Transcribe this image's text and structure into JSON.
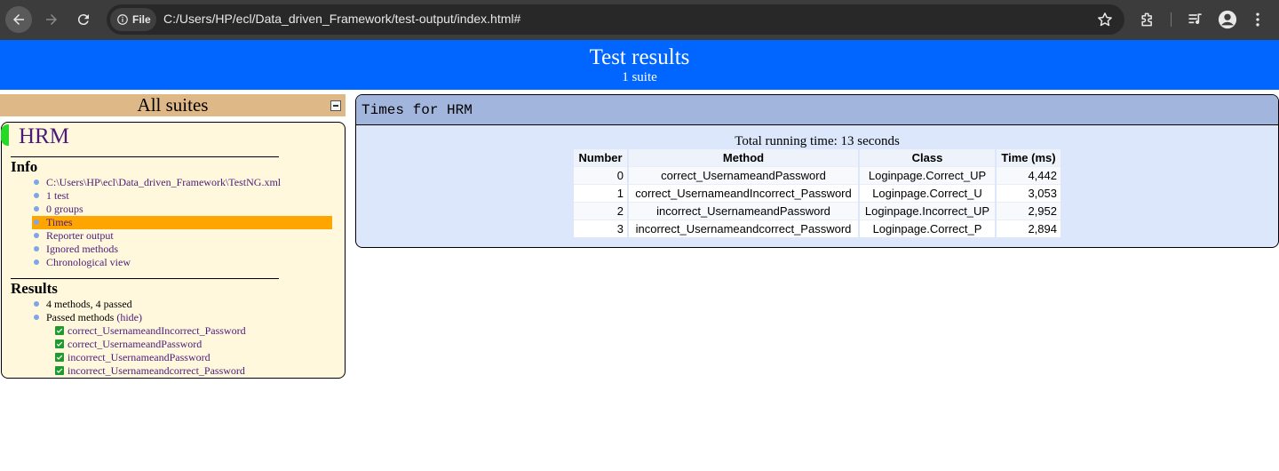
{
  "browser": {
    "chip_label": "File",
    "url": "C:/Users/HP/ecl/Data_driven_Framework/test-output/index.html#",
    "icons": [
      "back-arrow-icon",
      "forward-arrow-icon",
      "reload-icon",
      "info-icon",
      "star-icon",
      "extensions-icon",
      "media-icon",
      "profile-icon",
      "menu-icon"
    ]
  },
  "banner": {
    "title": "Test results",
    "subtitle": "1 suite"
  },
  "sidebar": {
    "header": "All suites",
    "suite_name": "HRM",
    "info_title": "Info",
    "info_items": [
      {
        "label": "C:\\Users\\HP\\ecl\\Data_driven_Framework\\TestNG.xml"
      },
      {
        "label": "1 test"
      },
      {
        "label": "0 groups"
      },
      {
        "label": "Times"
      },
      {
        "label": "Reporter output"
      },
      {
        "label": "Ignored methods"
      },
      {
        "label": "Chronological view"
      }
    ],
    "results_title": "Results",
    "results_summary": "4 methods, 4 passed",
    "passed_label": "Passed methods",
    "hide_label": "(hide)",
    "passed_methods": [
      "correct_UsernameandIncorrect_Password",
      "correct_UsernameandPassword",
      "incorrect_UsernameandPassword",
      "incorrect_Usernameandcorrect_Password"
    ]
  },
  "main": {
    "panel_title": "Times for HRM",
    "total_time": "Total running time: 13 seconds",
    "columns": [
      "Number",
      "Method",
      "Class",
      "Time (ms)"
    ],
    "rows": [
      [
        "0",
        "correct_UsernameandPassword",
        "Loginpage.Correct_UP",
        "4,442"
      ],
      [
        "1",
        "correct_UsernameandIncorrect_Password",
        "Loginpage.Correct_U",
        "3,053"
      ],
      [
        "2",
        "incorrect_UsernameandPassword",
        "Loginpage.Incorrect_UP",
        "2,952"
      ],
      [
        "3",
        "incorrect_Usernameandcorrect_Password",
        "Loginpage.Correct_P",
        "2,894"
      ]
    ]
  },
  "colors": {
    "banner": "#0066ff",
    "suites_header": "#deb887",
    "suite_bg": "#fff8dc",
    "selected": "#ffa500",
    "link": "#4b1b7a",
    "panel_header": "#a2b5dc",
    "panel_bg": "#dde7fb"
  }
}
